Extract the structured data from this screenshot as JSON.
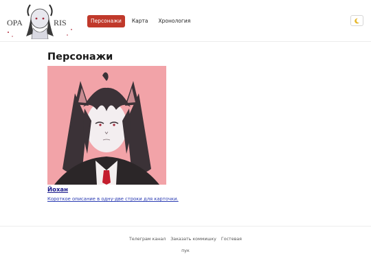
{
  "header": {
    "logo_text": "OPA IRIS",
    "nav": [
      {
        "label": "Персонажи",
        "active": true
      },
      {
        "label": "Карта",
        "active": false
      },
      {
        "label": "Хронология",
        "active": false
      }
    ],
    "theme_toggle_icon": "moon-icon"
  },
  "main": {
    "title": "Персонажи",
    "cards": [
      {
        "name": "Йохан",
        "description": "Короткое описание в одну-две строки для карточки.",
        "image_icon": "character-portrait"
      }
    ]
  },
  "footer": {
    "links": [
      "Телеграм канал",
      "Заказать коммишку",
      "Гостевая"
    ],
    "note": "пук"
  },
  "colors": {
    "accent": "#c0392b",
    "link": "#2a3bb3",
    "portrait_bg": "#f2a3a8"
  }
}
